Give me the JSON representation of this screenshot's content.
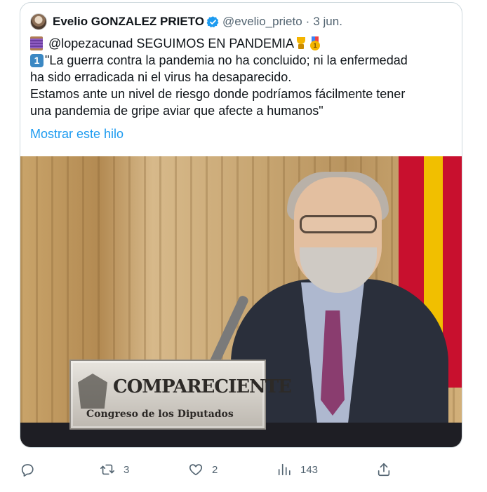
{
  "tweet": {
    "author": {
      "name": "Evelio GONZALEZ PRIETO",
      "handle": "@evelio_prieto",
      "separator": "·",
      "date": "3 jun.",
      "verified_icon": "verified-badge-icon"
    },
    "lines": {
      "l1": "@lopezacunad SEGUIMOS EN PANDEMIA",
      "l2_prefix": "1",
      "l2": "\"La guerra contra la pandemia no ha concluido; ni la enfermedad",
      "l3": "ha sido erradicada ni el virus ha desaparecido.",
      "l4": "Estamos ante un nivel de riesgo donde podríamos fácilmente tener",
      "l5": "una pandemia de gripe aviar que afecte a humanos\""
    },
    "show_thread": "Mostrar este hilo",
    "image": {
      "plate_title": "COMPARECIENTE",
      "plate_subtitle": "Congreso de los Diputados"
    },
    "actions": {
      "reply": {
        "icon": "reply-icon",
        "count": ""
      },
      "retweet": {
        "icon": "retweet-icon",
        "count": "3"
      },
      "like": {
        "icon": "heart-icon",
        "count": "2"
      },
      "views": {
        "icon": "analytics-icon",
        "count": "143"
      },
      "share": {
        "icon": "share-icon",
        "count": ""
      }
    }
  },
  "colors": {
    "text": "#0f1419",
    "muted": "#536471",
    "link": "#1d9bf0",
    "border": "#cfd9de"
  }
}
